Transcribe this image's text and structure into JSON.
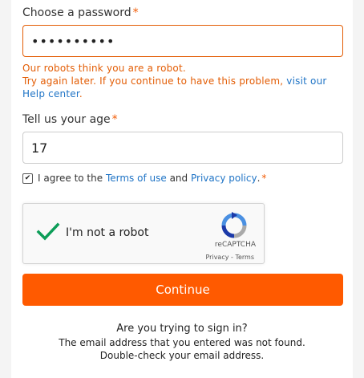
{
  "colors": {
    "accent": "#ff5a00",
    "error": "#e35d05",
    "link": "#1f74c6"
  },
  "password": {
    "label": "Choose a password",
    "required_mark": "*",
    "value": "••••••••••"
  },
  "error": {
    "line1": "Our robots think you are a robot.",
    "line2": "Try again later. If you continue to have this problem,",
    "link": "visit our Help center",
    "end": "."
  },
  "age": {
    "label": "Tell us your age",
    "required_mark": "*",
    "value": "17"
  },
  "terms": {
    "checked": true,
    "check_glyph": "✔",
    "prefix": "I agree to the",
    "terms_link": "Terms of use",
    "and": "and",
    "privacy_link": "Privacy policy",
    "end": ".",
    "required_mark": "*"
  },
  "captcha": {
    "label": "I'm not a robot",
    "brand": "reCAPTCHA",
    "links": "Privacy - Terms"
  },
  "continue_label": "Continue",
  "signin": {
    "question": "Are you trying to sign in?",
    "line1": "The email address that you entered was not found.",
    "line2": "Double-check your email address."
  }
}
